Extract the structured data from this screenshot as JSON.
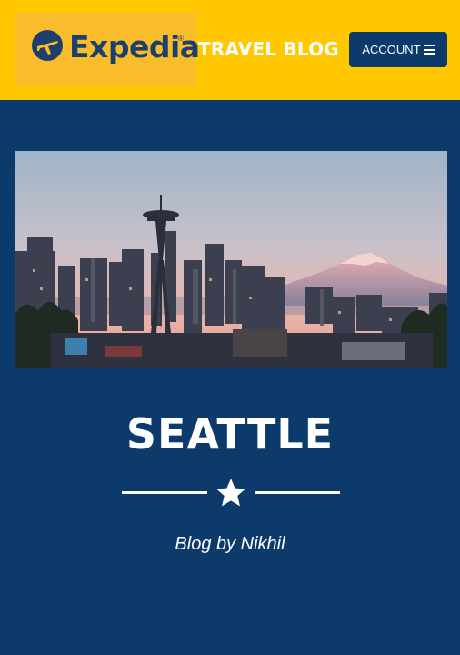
{
  "header": {
    "logo_text": "Expedia",
    "logo_trademark": "®",
    "blog_title": "TRAVEL BLOG",
    "account_label": "ACCOUNT",
    "menu_icon": "hamburger-icon"
  },
  "hero": {
    "image_subject": "Seattle skyline at dusk with Space Needle and Mount Rainier"
  },
  "post": {
    "title": "SEATTLE",
    "divider_icon": "star-icon",
    "byline": "Blog by Nikhil"
  },
  "colors": {
    "header_bg": "#ffc800",
    "page_bg": "#0b3a6b",
    "logo_text": "#1c3f6e"
  }
}
